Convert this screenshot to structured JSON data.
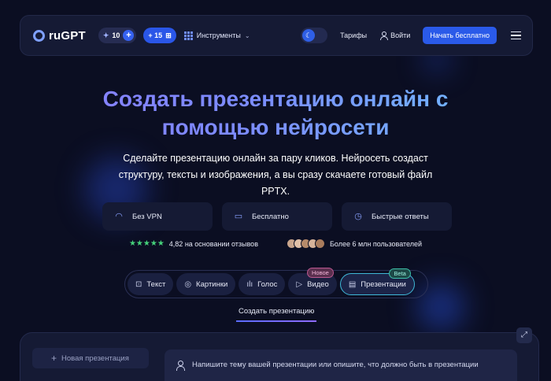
{
  "header": {
    "logo_text": "ruGPT",
    "credits": "10",
    "bonus": "+ 15",
    "tools_label": "Инструменты",
    "pricing": "Тарифы",
    "login": "Войти",
    "cta": "Начать бесплатно"
  },
  "hero": {
    "title_line1": "Создать презентацию онлайн с",
    "title_line2": "помощью нейросети",
    "subtitle": "Сделайте презентацию онлайн за пару кликов. Нейросеть создаст структуру, тексты и изображения, а вы сразу скачаете готовый файл PPTX."
  },
  "features": [
    {
      "label": "Без VPN",
      "icon": "wifi-icon"
    },
    {
      "label": "Бесплатно",
      "icon": "wallet-icon"
    },
    {
      "label": "Быстрые ответы",
      "icon": "timer-icon"
    }
  ],
  "social": {
    "rating_text": "4,82 на основании отзывов",
    "rating_value": 4.5,
    "users_text": "Более 6 млн пользователей"
  },
  "tabs": [
    {
      "label": "Текст",
      "icon": "text-icon"
    },
    {
      "label": "Картинки",
      "icon": "image-icon"
    },
    {
      "label": "Голос",
      "icon": "waveform-icon"
    },
    {
      "label": "Видео",
      "icon": "play-icon",
      "badge": "Новое"
    },
    {
      "label": "Презентации",
      "icon": "slides-icon",
      "badge": "Beta",
      "active": true
    }
  ],
  "subtab": "Создать презентацию",
  "panel": {
    "new_presentation": "Новая презентация",
    "prompt_text": "Напишите тему вашей презентации или опишите, что должно быть в презентации"
  },
  "colors": {
    "background": "#0b0e22",
    "accent": "#2a5ae9",
    "stars": "#45d07a"
  }
}
